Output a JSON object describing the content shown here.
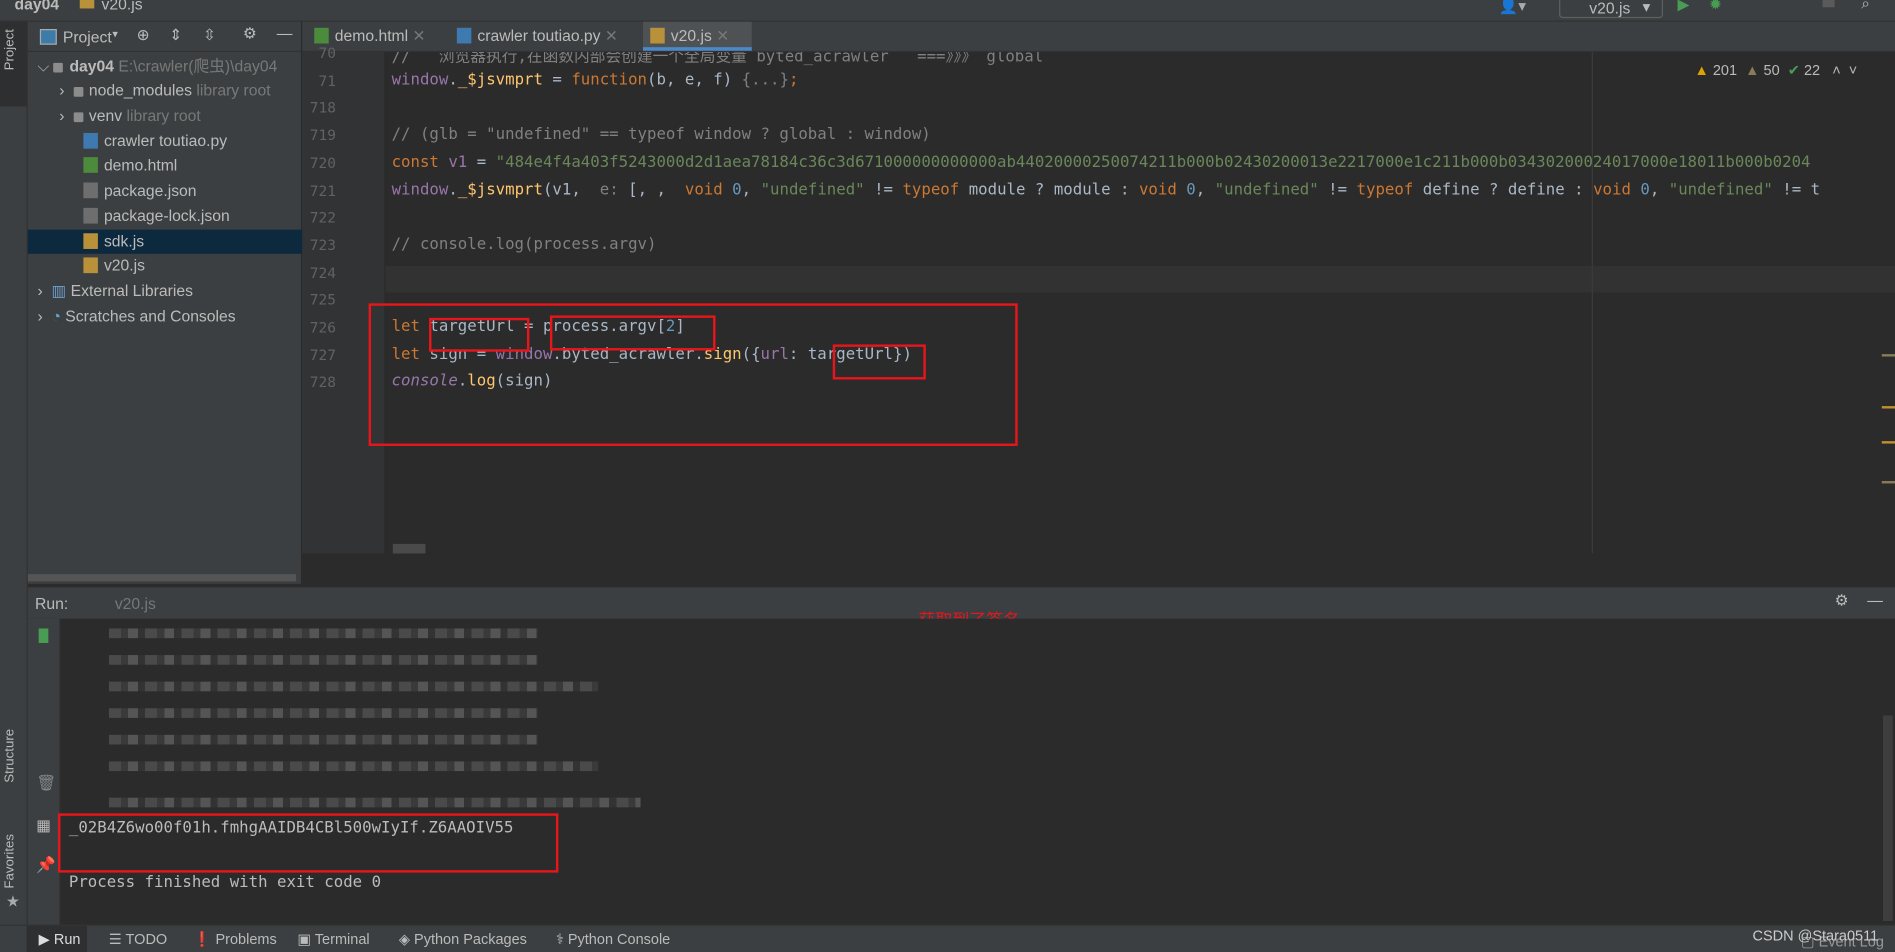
{
  "navbar": {
    "breadcrumb": [
      "day04",
      "v20.js"
    ],
    "run_config": "v20.js"
  },
  "left_stripe": {
    "project": "Project",
    "structure": "Structure",
    "favorites": "Favorites"
  },
  "project_panel": {
    "title": "Project",
    "items": [
      {
        "label": "day04",
        "hint": "E:\\crawler(爬虫)\\day04",
        "type": "folder",
        "expanded": true
      },
      {
        "label": "node_modules",
        "hint": "library root",
        "type": "folder"
      },
      {
        "label": "venv",
        "hint": "library root",
        "type": "folder"
      },
      {
        "label": "crawler toutiao.py",
        "type": "py"
      },
      {
        "label": "demo.html",
        "type": "html"
      },
      {
        "label": "package.json",
        "type": "json"
      },
      {
        "label": "package-lock.json",
        "type": "json"
      },
      {
        "label": "sdk.js",
        "type": "js",
        "selected": true
      },
      {
        "label": "v20.js",
        "type": "js"
      },
      {
        "label": "External Libraries",
        "type": "lib"
      },
      {
        "label": "Scratches and Consoles",
        "type": "scratch"
      }
    ]
  },
  "editor": {
    "tabs": [
      {
        "label": "demo.html"
      },
      {
        "label": "crawler toutiao.py"
      },
      {
        "label": "v20.js",
        "active": true
      }
    ],
    "inspections": {
      "warnings": "201",
      "weak_warnings": "50",
      "typos": "22"
    },
    "lines": [
      {
        "no": "70",
        "tokens": [
          [
            "c",
            "//   浏览器执行,在函数内部会创建一个全局变量 byted_acrawler   ===》》》 global"
          ]
        ]
      },
      {
        "no": "71",
        "tokens": [
          [
            "p",
            "window"
          ],
          [
            "d",
            "."
          ],
          [
            "f",
            "_$jsvmprt"
          ],
          [
            "d",
            " = "
          ],
          [
            "k",
            "function"
          ],
          [
            "d",
            "(b, e, f) "
          ],
          [
            "c",
            "{...}"
          ],
          [
            "k",
            ";"
          ]
        ]
      },
      {
        "no": "718",
        "tokens": []
      },
      {
        "no": "719",
        "tokens": [
          [
            "c",
            "// (glb = \"undefined\" == typeof window ? global : window)"
          ]
        ]
      },
      {
        "no": "720",
        "tokens": [
          [
            "k",
            "const "
          ],
          [
            "p",
            "v1"
          ],
          [
            "d",
            " = "
          ],
          [
            "s",
            "\"484e4f4a403f5243000d2d1aea78184c36c3d671000000000000ab44020000250074211b000b02430200013e2217000e1c211b000b03430200024017000e18011b000b0204"
          ]
        ]
      },
      {
        "no": "721",
        "tokens": [
          [
            "p",
            "window"
          ],
          [
            "d",
            "."
          ],
          [
            "f",
            "_$jsvmprt"
          ],
          [
            "d",
            "(v1,  "
          ],
          [
            "c",
            "e:"
          ],
          [
            "d",
            " [, ,  "
          ],
          [
            "k",
            "void "
          ],
          [
            "n",
            "0"
          ],
          [
            "d",
            ", "
          ],
          [
            "s",
            "\"undefined\""
          ],
          [
            "d",
            " != "
          ],
          [
            "k",
            "typeof "
          ],
          [
            "d",
            "module ? module : "
          ],
          [
            "k",
            "void "
          ],
          [
            "n",
            "0"
          ],
          [
            "d",
            ", "
          ],
          [
            "s",
            "\"undefined\""
          ],
          [
            "d",
            " != "
          ],
          [
            "k",
            "typeof "
          ],
          [
            "d",
            "define ? define : "
          ],
          [
            "k",
            "void "
          ],
          [
            "n",
            "0"
          ],
          [
            "d",
            ", "
          ],
          [
            "s",
            "\"undefined\""
          ],
          [
            "d",
            " != t"
          ]
        ]
      },
      {
        "no": "722",
        "tokens": []
      },
      {
        "no": "723",
        "tokens": [
          [
            "c",
            "// console.log(process.argv)"
          ]
        ]
      },
      {
        "no": "724",
        "tokens": []
      },
      {
        "no": "725",
        "tokens": []
      },
      {
        "no": "726",
        "tokens": [
          [
            "k",
            "let "
          ],
          [
            "d",
            "targetUrl = "
          ],
          [
            "d",
            "process.argv"
          ],
          [
            "d",
            "["
          ],
          [
            "n",
            "2"
          ],
          [
            "d",
            "]"
          ]
        ]
      },
      {
        "no": "727",
        "tokens": [
          [
            "k",
            "let "
          ],
          [
            "d",
            "sign = "
          ],
          [
            "p",
            "window"
          ],
          [
            "d",
            ".byted_acrawler."
          ],
          [
            "f",
            "sign"
          ],
          [
            "d",
            "({"
          ],
          [
            "p",
            "url"
          ],
          [
            "d",
            ": targetUrl})"
          ]
        ]
      },
      {
        "no": "728",
        "tokens": [
          [
            "i",
            "console"
          ],
          [
            "d",
            "."
          ],
          [
            "f",
            "log"
          ],
          [
            "d",
            "(sign)"
          ]
        ]
      }
    ]
  },
  "annotation": "获取到了签名",
  "run": {
    "label": "Run:",
    "config": "v20.js",
    "signature": "_02B4Z6wo00f01h.fmhgAAIDB4CBl500wIyIf.Z6AAOIV55",
    "exit": "Process finished with exit code 0"
  },
  "bottom_tabs": [
    {
      "label": "Run",
      "icon": "play-icon"
    },
    {
      "label": "TODO",
      "icon": "list-icon"
    },
    {
      "label": "Problems",
      "icon": "problems-icon"
    },
    {
      "label": "Terminal",
      "icon": "terminal-icon"
    },
    {
      "label": "Python Packages",
      "icon": "packages-icon"
    },
    {
      "label": "Python Console",
      "icon": "python-icon"
    }
  ],
  "status": {
    "event_log": "Event Log"
  },
  "watermark": "CSDN @Stara0511",
  "colors": {
    "highlight_box": "#e8161b",
    "selection": "#0d293e",
    "keyword": "#cc7832",
    "string": "#6a8759"
  }
}
